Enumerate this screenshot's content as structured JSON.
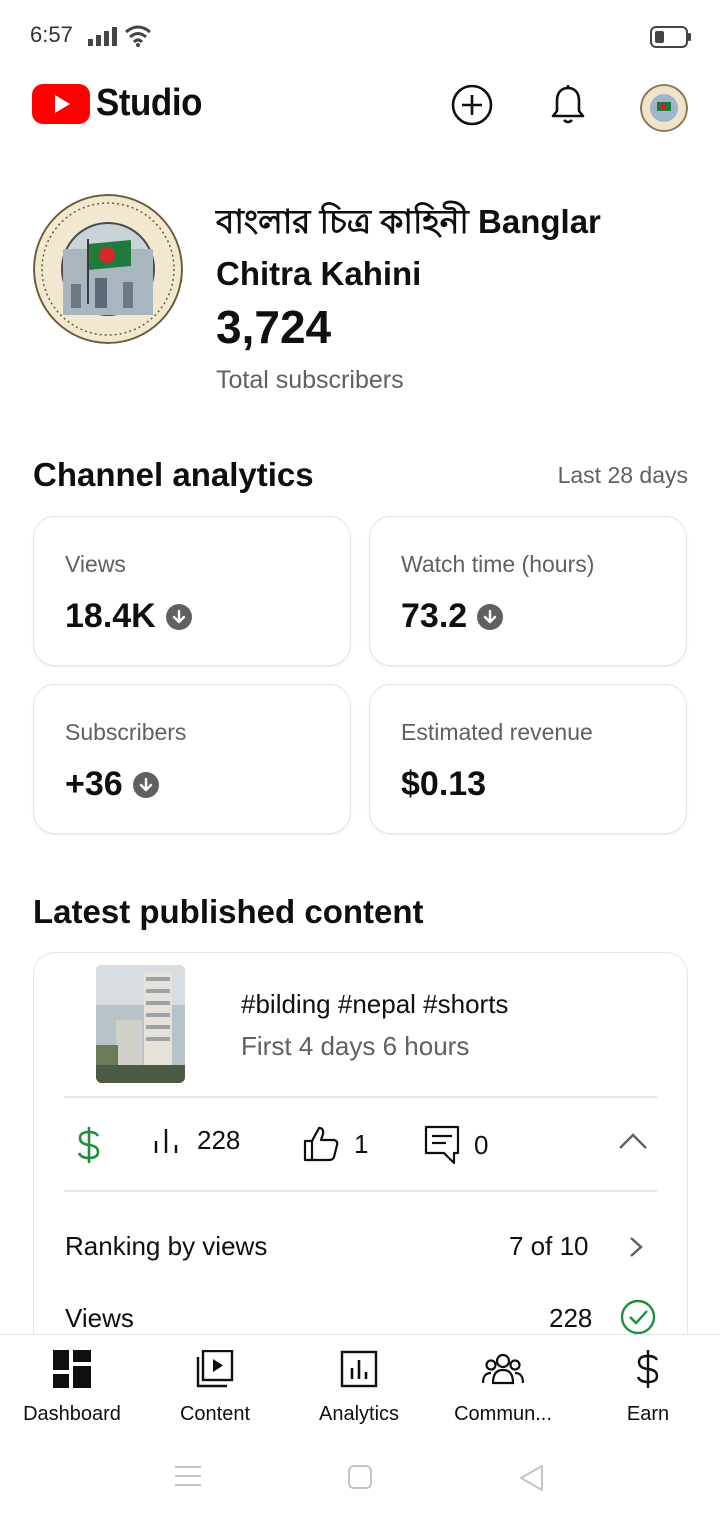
{
  "status": {
    "time": "6:57"
  },
  "header": {
    "app_name": "Studio",
    "add_icon": "add-circle-icon",
    "bell_icon": "bell-icon"
  },
  "channel": {
    "name": "বাংলার চিত্র কাহিনী Banglar Chitra Kahini",
    "subscribers": "3,724",
    "subscribers_label": "Total subscribers",
    "logo_text": "Banglar Chitra Kahini"
  },
  "analytics": {
    "title": "Channel analytics",
    "range": "Last 28 days",
    "cards": [
      {
        "label": "Views",
        "value": "18.4K",
        "trend": "down"
      },
      {
        "label": "Watch time (hours)",
        "value": "73.2",
        "trend": "down"
      },
      {
        "label": "Subscribers",
        "value": "+36",
        "trend": "down"
      },
      {
        "label": "Estimated revenue",
        "value": "$0.13",
        "trend": "none"
      }
    ]
  },
  "latest": {
    "title": "Latest published content",
    "video": {
      "title": "#bilding #nepal #shorts",
      "subtitle": "First 4 days 6 hours",
      "views": "228",
      "likes": "1",
      "comments": "0"
    },
    "rows": [
      {
        "label": "Ranking by views",
        "value": "7 of 10"
      },
      {
        "label": "Views",
        "value": "228"
      }
    ]
  },
  "nav": {
    "items": [
      {
        "label": "Dashboard",
        "icon": "dashboard-icon",
        "active": true
      },
      {
        "label": "Content",
        "icon": "content-icon"
      },
      {
        "label": "Analytics",
        "icon": "analytics-icon"
      },
      {
        "label": "Commun...",
        "icon": "community-icon"
      },
      {
        "label": "Earn",
        "icon": "dollar-icon"
      }
    ]
  },
  "colors": {
    "brand_red": "#ff0000",
    "revenue_green": "#1e8e3e",
    "text_secondary": "#606060"
  }
}
